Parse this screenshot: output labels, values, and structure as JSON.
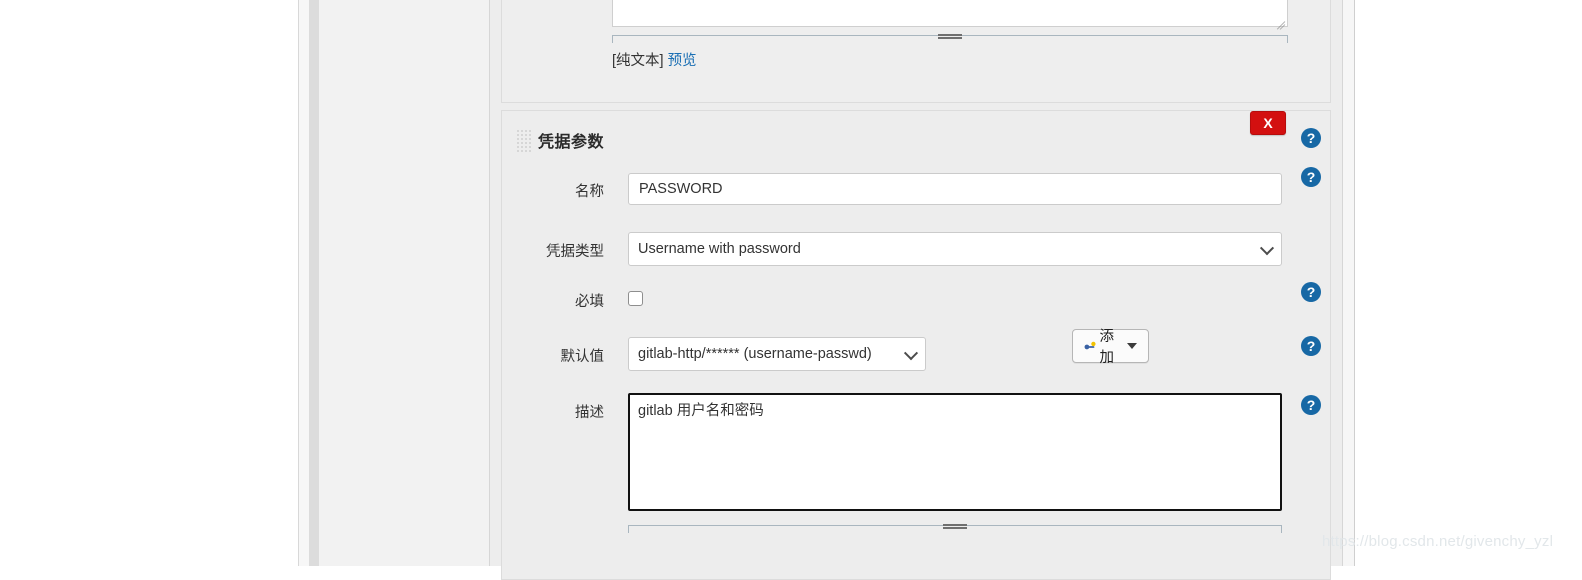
{
  "upper_panel": {
    "textarea_value": "",
    "plaintext_label": "[纯文本]",
    "preview_link": "预览"
  },
  "panel": {
    "title": "凭据参数",
    "delete_label": "X",
    "drag_handle_name": "drag-grip-icon"
  },
  "fields": {
    "name": {
      "label": "名称",
      "value": "PASSWORD",
      "placeholder": ""
    },
    "credential_type": {
      "label": "凭据类型",
      "value": "Username with password",
      "options": [
        "Username with password"
      ]
    },
    "required": {
      "label": "必填",
      "checked": false
    },
    "default_value": {
      "label": "默认值",
      "value": "gitlab-http/****** (username-passwd)",
      "options": [
        "gitlab-http/****** (username-passwd)"
      ],
      "add_button_label": "添加"
    },
    "description": {
      "label": "描述",
      "value": "gitlab 用户名和密码",
      "placeholder": ""
    }
  },
  "help": {
    "glyph": "?"
  },
  "colors": {
    "panel_bg": "#ededed",
    "link": "#1a6fb4",
    "delete_red": "#d31010",
    "help_blue": "#1768a5",
    "focus_border": "#111111"
  },
  "watermark": {
    "text": "https://blog.csdn.net/givenchy_yzl"
  }
}
